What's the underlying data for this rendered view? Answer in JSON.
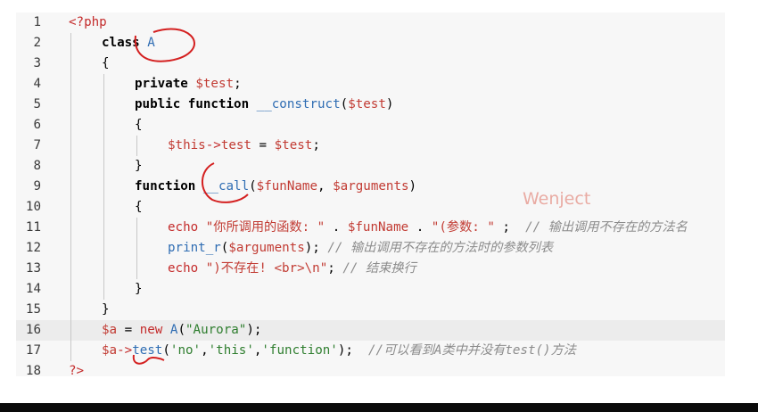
{
  "lines": [
    {
      "n": "1",
      "indent": 0,
      "tokens": [
        {
          "t": "<?php",
          "c": "kw2"
        }
      ]
    },
    {
      "n": "2",
      "indent": 1,
      "tokens": [
        {
          "t": "class ",
          "c": "kw"
        },
        {
          "t": "A",
          "c": "fn"
        }
      ]
    },
    {
      "n": "3",
      "indent": 1,
      "tokens": [
        {
          "t": "{",
          "c": ""
        }
      ]
    },
    {
      "n": "4",
      "indent": 2,
      "tokens": [
        {
          "t": "private ",
          "c": "kw"
        },
        {
          "t": "$test",
          "c": "var"
        },
        {
          "t": ";",
          "c": ""
        }
      ]
    },
    {
      "n": "5",
      "indent": 2,
      "tokens": [
        {
          "t": "public function ",
          "c": "kw"
        },
        {
          "t": "__construct",
          "c": "fn"
        },
        {
          "t": "(",
          "c": ""
        },
        {
          "t": "$test",
          "c": "var"
        },
        {
          "t": ")",
          "c": ""
        }
      ]
    },
    {
      "n": "6",
      "indent": 2,
      "tokens": [
        {
          "t": "{",
          "c": ""
        }
      ]
    },
    {
      "n": "7",
      "indent": 3,
      "tokens": [
        {
          "t": "$this",
          "c": "var"
        },
        {
          "t": "->",
          "c": "kw2"
        },
        {
          "t": "test",
          "c": "var"
        },
        {
          "t": " = ",
          "c": ""
        },
        {
          "t": "$test",
          "c": "var"
        },
        {
          "t": ";",
          "c": ""
        }
      ]
    },
    {
      "n": "8",
      "indent": 2,
      "tokens": [
        {
          "t": "}",
          "c": ""
        }
      ]
    },
    {
      "n": "9",
      "indent": 2,
      "tokens": [
        {
          "t": "function ",
          "c": "kw"
        },
        {
          "t": "__call",
          "c": "fn"
        },
        {
          "t": "(",
          "c": ""
        },
        {
          "t": "$funName",
          "c": "var"
        },
        {
          "t": ", ",
          "c": ""
        },
        {
          "t": "$arguments",
          "c": "var"
        },
        {
          "t": ")",
          "c": ""
        }
      ]
    },
    {
      "n": "10",
      "indent": 2,
      "tokens": [
        {
          "t": "{",
          "c": ""
        }
      ]
    },
    {
      "n": "11",
      "indent": 3,
      "tokens": [
        {
          "t": "echo ",
          "c": "kw2"
        },
        {
          "t": "\"你所调用的函数: \"",
          "c": "str2"
        },
        {
          "t": " . ",
          "c": ""
        },
        {
          "t": "$funName",
          "c": "var"
        },
        {
          "t": " . ",
          "c": ""
        },
        {
          "t": "\"(参数: \"",
          "c": "str2"
        },
        {
          "t": " ;  ",
          "c": ""
        },
        {
          "t": "// 输出调用不存在的方法名",
          "c": "cmt"
        }
      ]
    },
    {
      "n": "12",
      "indent": 3,
      "tokens": [
        {
          "t": "print_r",
          "c": "fn"
        },
        {
          "t": "(",
          "c": ""
        },
        {
          "t": "$arguments",
          "c": "var"
        },
        {
          "t": "); ",
          "c": ""
        },
        {
          "t": "// 输出调用不存在的方法时的参数列表",
          "c": "cmt"
        }
      ]
    },
    {
      "n": "13",
      "indent": 3,
      "tokens": [
        {
          "t": "echo ",
          "c": "kw2"
        },
        {
          "t": "\")不存在! <br>\\n\"",
          "c": "str2"
        },
        {
          "t": "; ",
          "c": ""
        },
        {
          "t": "// 结束换行",
          "c": "cmt"
        }
      ]
    },
    {
      "n": "14",
      "indent": 2,
      "tokens": [
        {
          "t": "}",
          "c": ""
        }
      ]
    },
    {
      "n": "15",
      "indent": 1,
      "tokens": [
        {
          "t": "}",
          "c": ""
        }
      ]
    },
    {
      "n": "16",
      "indent": 1,
      "tokens": [
        {
          "t": "$a",
          "c": "var"
        },
        {
          "t": " = ",
          "c": ""
        },
        {
          "t": "new ",
          "c": "kw2"
        },
        {
          "t": "A",
          "c": "fn"
        },
        {
          "t": "(",
          "c": ""
        },
        {
          "t": "\"Aurora\"",
          "c": "str"
        },
        {
          "t": ");",
          "c": ""
        }
      ]
    },
    {
      "n": "17",
      "indent": 1,
      "tokens": [
        {
          "t": "$a",
          "c": "var"
        },
        {
          "t": "->",
          "c": "kw2"
        },
        {
          "t": "test",
          "c": "fn"
        },
        {
          "t": "(",
          "c": ""
        },
        {
          "t": "'no'",
          "c": "str"
        },
        {
          "t": ",",
          "c": ""
        },
        {
          "t": "'this'",
          "c": "str"
        },
        {
          "t": ",",
          "c": ""
        },
        {
          "t": "'function'",
          "c": "str"
        },
        {
          "t": ");  ",
          "c": ""
        },
        {
          "t": "//可以看到A类中并没有test()方法",
          "c": "cmt"
        }
      ]
    },
    {
      "n": "18",
      "indent": 0,
      "tokens": [
        {
          "t": "?>",
          "c": "kw2"
        }
      ]
    }
  ],
  "highlighted_line": "16",
  "watermark": "Wenject",
  "colors": {
    "annotation_ink": "#d42020",
    "background": "#f7f7f7"
  }
}
